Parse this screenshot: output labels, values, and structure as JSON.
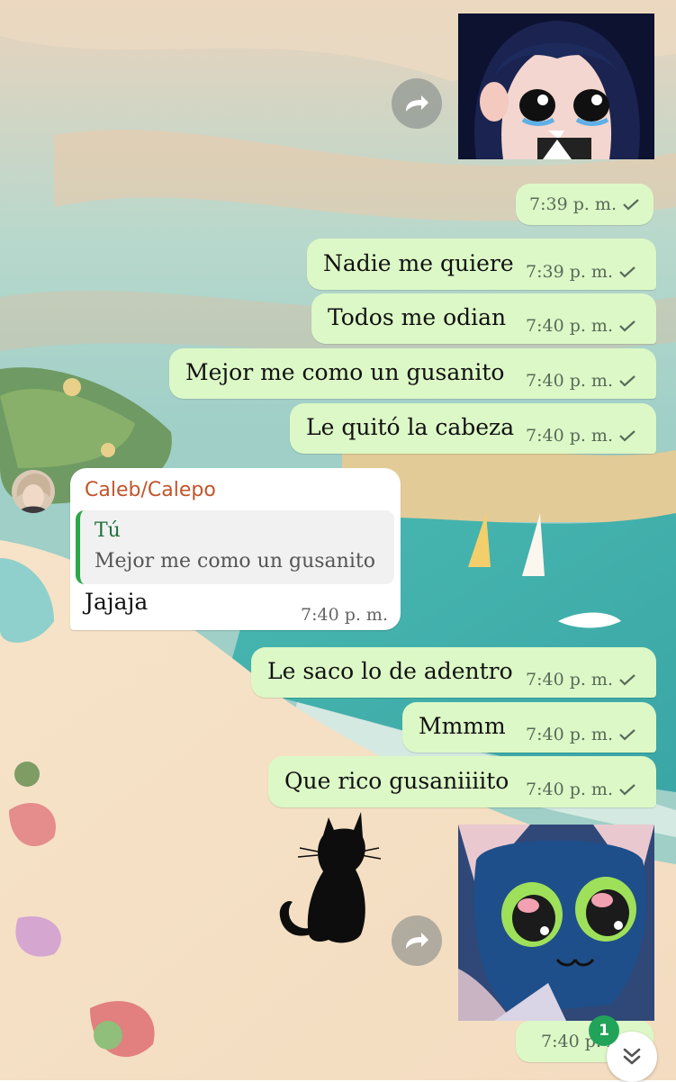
{
  "messages": [
    {
      "text": "Nadie me quiere",
      "time": "7:39 p. m."
    },
    {
      "text": "Todos me odian",
      "time": "7:40 p. m."
    },
    {
      "text": "Mejor me como un gusanito",
      "time": "7:40 p. m."
    },
    {
      "text": "Le quitó la cabeza",
      "time": "7:40 p. m."
    },
    {
      "text": "Le saco lo de adentro",
      "time": "7:40 p. m."
    },
    {
      "text": "Mmmm",
      "time": "7:40 p. m."
    },
    {
      "text": "Que rico gusaniiiito",
      "time": "7:40 p. m."
    }
  ],
  "sticker_times": [
    "7:39 p. m.",
    "7:40 p. m."
  ],
  "incoming": {
    "sender": "Caleb/Calepo",
    "quote_author": "Tú",
    "quote_text": "Mejor me como un gusanito",
    "text": "Jajaja",
    "time": "7:40 p. m."
  },
  "unread_badge": "1",
  "icons": {
    "forward": "forward-arrow-icon",
    "read_tick": "check-icon",
    "scroll_down": "double-chevron-down-icon"
  },
  "colors": {
    "outgoing_bubble": "#dcf8c6",
    "incoming_bubble": "#ffffff",
    "sender_name": "#c1542b",
    "quote_bar": "#2aa748",
    "badge": "#22a35a"
  }
}
